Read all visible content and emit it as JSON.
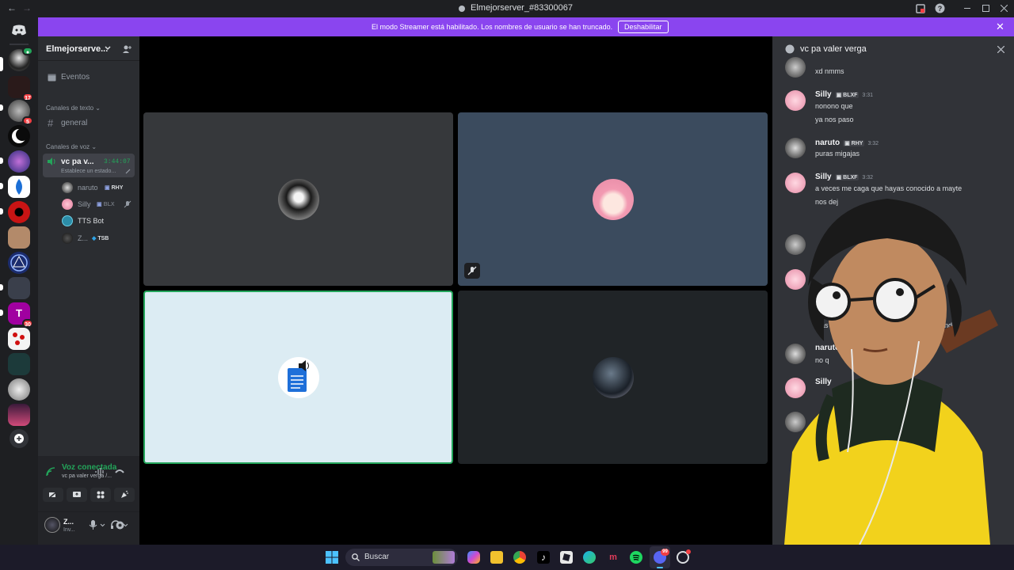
{
  "window": {
    "title": "Elmejorserver_#83300067",
    "nav_back": "←",
    "nav_forward": "→"
  },
  "banner": {
    "message": "El modo Streamer está habilitado. Los nombres de usuario se han truncado.",
    "button": "Deshabilitar",
    "close": "✕"
  },
  "rail": {
    "badges": [
      "17",
      "5",
      "30"
    ]
  },
  "sidebar": {
    "server_name": "Elmejorserve...",
    "events": "Eventos",
    "text_category": "Canales de texto",
    "text_channels": [
      {
        "name": "general"
      }
    ],
    "voice_category": "Canales de voz",
    "voice_channel": {
      "name": "vc pa v...",
      "timer": "3:44:07",
      "status": "Establece un estado..."
    },
    "members": [
      {
        "name": "naruto",
        "tag": "RHY"
      },
      {
        "name": "Silly",
        "tag": "BLX"
      },
      {
        "name": "TTS Bot",
        "tag": ""
      },
      {
        "name": "Z...",
        "tag": "TSB"
      }
    ],
    "voice_status": {
      "title": "Voz conectada",
      "channel": "vc pa valer verga /..."
    },
    "user": {
      "name": "Z...",
      "status": "Inv..."
    }
  },
  "chat": {
    "title": "vc pa valer verga",
    "messages": [
      {
        "author": "",
        "role": "",
        "time": "",
        "lines": [
          "xd nmms"
        ]
      },
      {
        "author": "Silly",
        "role": "BLXF",
        "time": "3:31",
        "lines": [
          "nonono que",
          "ya nos paso"
        ]
      },
      {
        "author": "naruto",
        "role": "RHY",
        "time": "3:32",
        "lines": [
          "puras migajas"
        ]
      },
      {
        "author": "Silly",
        "role": "BLXF",
        "time": "3:32",
        "lines": [
          "a veces me caga que hayas conocido a mayte",
          "nos dej"
        ]
      },
      {
        "author": "",
        "role": "",
        "time": "",
        "lines": [
          "os",
          "ibas",
          "os abandonaste"
        ]
      },
      {
        "author": "naruto",
        "role": "",
        "time": "",
        "lines": [
          "no q"
        ]
      },
      {
        "author": "Silly",
        "role": "",
        "time": "",
        "lines": []
      }
    ]
  },
  "taskbar": {
    "search": "Buscar",
    "discord_badge": "99"
  },
  "colors": {
    "accent": "#8a45ef",
    "voice_green": "#23a55a",
    "tile_grey": "#36383b",
    "tile_blue": "#3b4b5e",
    "tile_light": "#dcecf3",
    "tile_dark": "#202427"
  }
}
